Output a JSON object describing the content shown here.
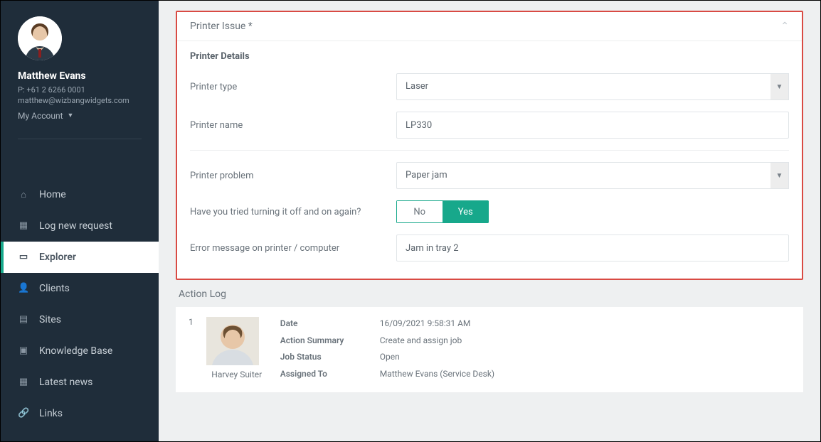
{
  "profile": {
    "name": "Matthew Evans",
    "phone": "P: +61 2 6266 0001",
    "email": "matthew@wizbangwidgets.com",
    "my_account_label": "My Account"
  },
  "nav": {
    "items": [
      {
        "id": "home",
        "label": "Home",
        "icon": "home-icon",
        "glyph": "⌂"
      },
      {
        "id": "log-new-request",
        "label": "Log new request",
        "icon": "grid-icon",
        "glyph": "▦"
      },
      {
        "id": "explorer",
        "label": "Explorer",
        "icon": "laptop-icon",
        "glyph": "▭",
        "active": true
      },
      {
        "id": "clients",
        "label": "Clients",
        "icon": "user-icon",
        "glyph": "👤"
      },
      {
        "id": "sites",
        "label": "Sites",
        "icon": "page-icon",
        "glyph": "▤"
      },
      {
        "id": "knowledge-base",
        "label": "Knowledge Base",
        "icon": "book-icon",
        "glyph": "▣"
      },
      {
        "id": "latest-news",
        "label": "Latest news",
        "icon": "news-icon",
        "glyph": "▦"
      },
      {
        "id": "links",
        "label": "Links",
        "icon": "link-icon",
        "glyph": "🔗"
      }
    ]
  },
  "panel": {
    "title": "Printer Issue *",
    "section_label": "Printer Details",
    "fields": {
      "printer_type": {
        "label": "Printer type",
        "value": "Laser"
      },
      "printer_name": {
        "label": "Printer name",
        "value": "LP330"
      },
      "printer_problem": {
        "label": "Printer problem",
        "value": "Paper jam"
      },
      "tried_power_cycle": {
        "label": "Have you tried turning it off and on again?",
        "no": "No",
        "yes": "Yes",
        "value": "yes"
      },
      "error_message": {
        "label": "Error message on printer / computer",
        "value": "Jam in tray 2"
      }
    }
  },
  "action_log": {
    "title": "Action Log",
    "entries": [
      {
        "index": "1",
        "actor": "Harvey Suiter",
        "rows": {
          "date": {
            "label": "Date",
            "value": "16/09/2021 9:58:31 AM"
          },
          "summary": {
            "label": "Action Summary",
            "value": "Create and assign job"
          },
          "status": {
            "label": "Job Status",
            "value": "Open"
          },
          "assigned_to": {
            "label": "Assigned To",
            "value": "Matthew Evans (Service Desk)"
          }
        }
      }
    ]
  }
}
